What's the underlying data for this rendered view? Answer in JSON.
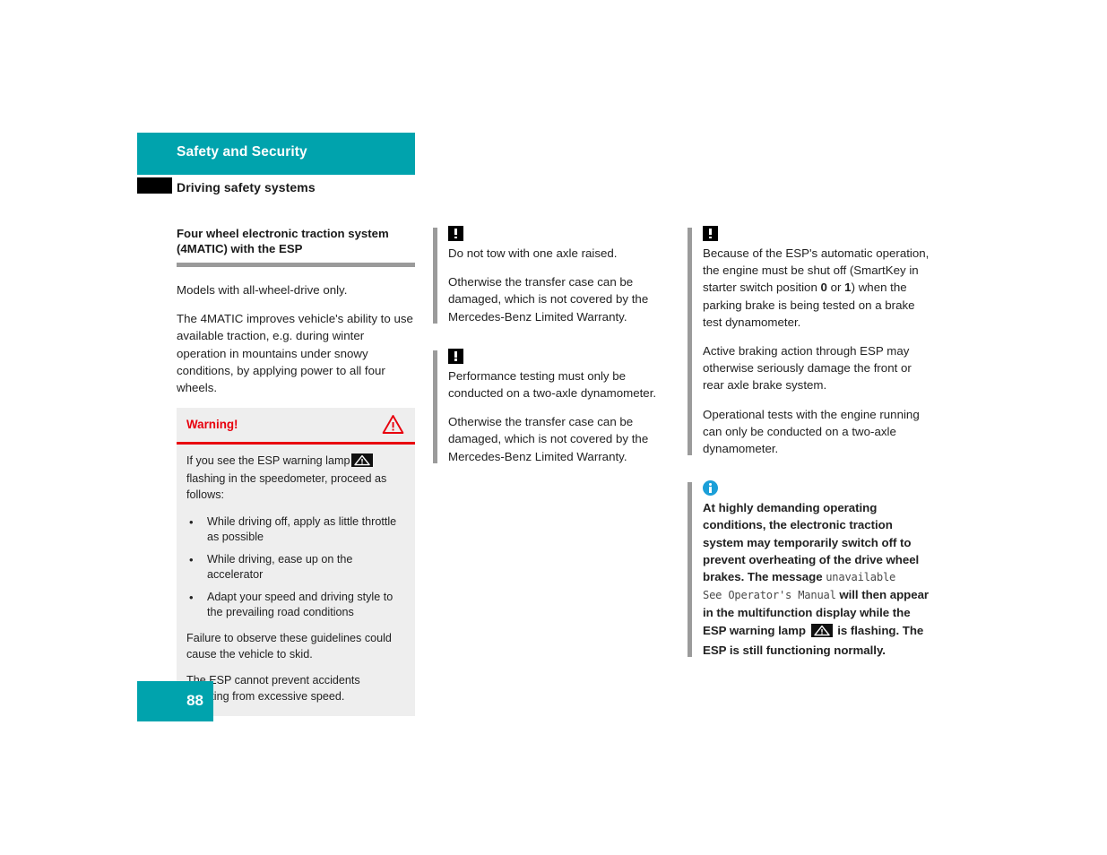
{
  "header": {
    "band_title": "Safety and Security",
    "sub_title": "Driving safety systems"
  },
  "column1": {
    "section_title": "Four wheel electronic traction system (4MATIC) with the ESP",
    "paragraphs": [
      "Models with all-wheel-drive only.",
      "The 4MATIC improves vehicle's ability to use available traction, e.g. during winter operation in mountains under snowy conditions, by applying power to all four wheels."
    ],
    "warning_box": {
      "title": "Warning!",
      "icon": "warning-triangle-icon",
      "intro_before_lamp": "If you see the ESP warning lamp",
      "lamp_icon": "esp-warning-lamp-icon",
      "intro_after_lamp": "flashing in the speedometer, proceed as follows:",
      "bullet_char": "•",
      "bullets": [
        "While driving off, apply as little throttle as possible",
        "While driving, ease up on the accelerator",
        "Adapt your speed and driving style to the prevailing road conditions"
      ],
      "closing_paragraphs": [
        "Failure to observe these guidelines could cause the vehicle to skid.",
        "The ESP cannot prevent accidents resulting from excessive speed."
      ]
    }
  },
  "column2": {
    "notes": [
      {
        "icon": "caution-exclamation-icon",
        "paragraphs": [
          "Do not tow with one axle raised.",
          "Otherwise the transfer case can be damaged, which is not covered by the Mercedes-Benz Limited Warranty."
        ]
      },
      {
        "icon": "caution-exclamation-icon",
        "paragraphs": [
          "Performance testing must only be conducted on a two-axle dynamometer.",
          "Otherwise the transfer case can be damaged, which is not covered by the Mercedes-Benz Limited Warranty."
        ]
      }
    ]
  },
  "column3": {
    "caution_note": {
      "icon": "caution-exclamation-icon",
      "para1_part1": "Because of the ESP's automatic operation, the engine must be shut off (SmartKey in starter switch position ",
      "para1_bold1": "0",
      "para1_part2": " or ",
      "para1_bold2": "1",
      "para1_part3": ") when the parking brake is being tested on a brake test dynamometer.",
      "paragraphs": [
        "Active braking action through ESP may otherwise seriously damage the front or rear axle brake system.",
        "Operational tests with the engine running can only be conducted on a two-axle dynamometer."
      ]
    },
    "info_note": {
      "icon": "info-circle-icon",
      "part1": "At highly demanding operating conditions, the electronic traction system may temporarily switch off to prevent overheating of the drive wheel brakes. The message ",
      "mono1": "unavailable",
      "mono2": "See Operator's Manual",
      "part2": " will then appear in the multifunction display while the ESP warning lamp ",
      "lamp_icon": "esp-warning-lamp-icon",
      "part3": " is flashing. The ESP is still functioning normally."
    }
  },
  "footer": {
    "page_number": "88"
  },
  "colors": {
    "teal": "#00a3ad",
    "warning_red": "#e8000d",
    "info_blue": "#1b9fd8",
    "note_bar_gray": "#9b9b9b",
    "rule_gray": "#9a9a9a",
    "warning_box_bg": "#eeeeee"
  }
}
